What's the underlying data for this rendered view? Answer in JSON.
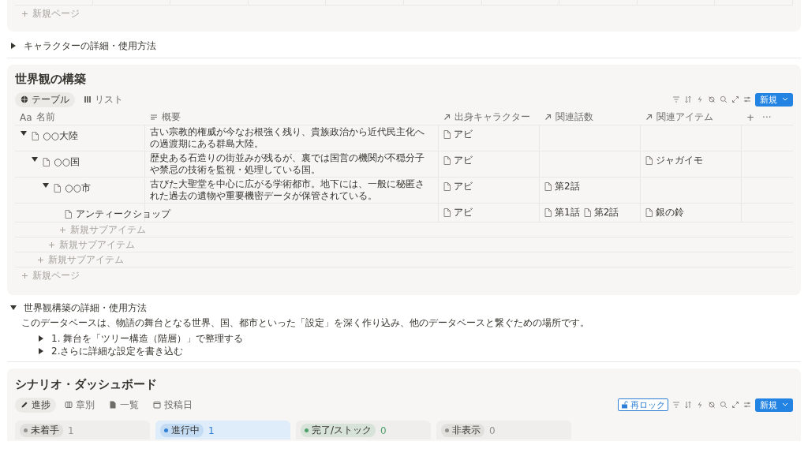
{
  "top_card": {
    "new_page": "新規ページ"
  },
  "character_toggle": {
    "title": "キャラクターの詳細・使用方法",
    "expanded": false
  },
  "world": {
    "title": "世界観の構築",
    "views": [
      {
        "kind": "table",
        "label": "テーブル",
        "selected": true
      },
      {
        "kind": "list",
        "label": "リスト",
        "selected": false
      }
    ],
    "new_button": "新規",
    "columns": [
      {
        "kind": "title",
        "mark": "Aa",
        "label": "名前"
      },
      {
        "kind": "text",
        "label": "概要"
      },
      {
        "kind": "relation",
        "label": "出身キャラクター"
      },
      {
        "kind": "relation",
        "label": "関連話数"
      },
      {
        "kind": "relation",
        "label": "関連アイテム"
      }
    ],
    "add_column": "+",
    "more": "···",
    "rows": [
      {
        "name": "○○大陸",
        "expanded": true,
        "summary": "古い宗教的権威が今なお根強く残り、貴族政治から近代民主化への過渡期にある群島大陸。",
        "characters": [
          "アビ"
        ],
        "add_label": "新規サブアイテム",
        "children": [
          {
            "name": "○○国",
            "expanded": true,
            "summary": "歴史ある石造りの街並みが残るが、裏では国営の機関が不穏分子や禁忌の技術を監視・処理している国。",
            "characters": [
              "アビ"
            ],
            "items": [
              "ジャガイモ"
            ],
            "add_label": "新規サブアイテム",
            "children": [
              {
                "name": "○○市",
                "expanded": true,
                "summary": "古びた大聖堂を中心に広がる学術都市。地下には、一般に秘匿された過去の遺物や重要機密データが保管されている。",
                "characters": [
                  "アビ"
                ],
                "episodes": [
                  "第2話"
                ],
                "add_label": "新規サブアイテム",
                "children": [
                  {
                    "name": "アンティークショップ",
                    "characters": [
                      "アビ"
                    ],
                    "episodes": [
                      "第1話",
                      "第2話"
                    ],
                    "items": [
                      "銀の鈴"
                    ]
                  }
                ]
              }
            ]
          }
        ]
      }
    ],
    "new_page": "新規ページ"
  },
  "world_toggle": {
    "title": "世界観構築の詳細・使用方法",
    "expanded": true,
    "text": "このデータベースは、物語の舞台となる世界、国、都市といった「設定」を深く作り込み、他のデータベースと繋ぐための場所です。",
    "children": [
      {
        "title": "1. 舞台を「ツリー構造（階層）」で整理する",
        "expanded": false
      },
      {
        "title": "2.さらに詳細な設定を書き込む",
        "expanded": false
      }
    ]
  },
  "scenario": {
    "title": "シナリオ・ダッシュボード",
    "views": [
      {
        "kind": "pen",
        "label": "進捗",
        "selected": true
      },
      {
        "kind": "board",
        "label": "章別",
        "selected": false
      },
      {
        "kind": "page",
        "label": "一覧",
        "selected": false
      },
      {
        "kind": "calendar",
        "label": "投稿日",
        "selected": false
      }
    ],
    "lock_button": "再ロック",
    "new_button": "新規",
    "groups": [
      {
        "label": "未着手",
        "count": "1",
        "color": "#91918e",
        "tinted": false
      },
      {
        "label": "進行中",
        "count": "1",
        "color": "#2f80d6",
        "tinted": true
      },
      {
        "label": "完了/ストック",
        "count": "0",
        "color": "#4e9f6a",
        "tinted": false
      },
      {
        "label": "非表示",
        "count": "0",
        "color": "#91918e",
        "tinted": false
      }
    ]
  }
}
